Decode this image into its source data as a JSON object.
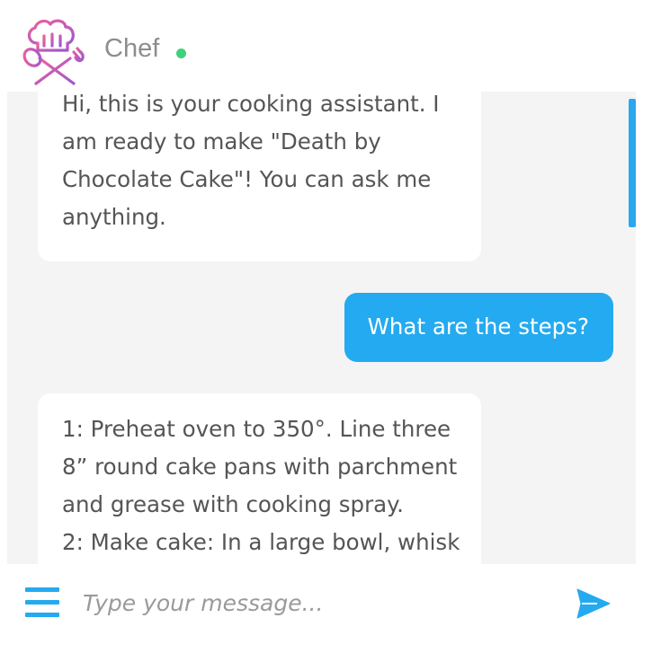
{
  "header": {
    "bot_name": "Chef",
    "status": "online",
    "status_color": "#3ed17b",
    "logo_icon": "chef-hat-utensils-icon"
  },
  "messages": [
    {
      "sender": "bot",
      "lines": [
        "Hi, this is your cooking assistant. I",
        "am ready to make \"Death by",
        "Chocolate Cake\"! You can ask me",
        "anything."
      ]
    },
    {
      "sender": "user",
      "text": "What are the steps?"
    },
    {
      "sender": "bot",
      "lines": [
        "1: Preheat oven to 350°. Line three",
        "8” round cake pans with parchment",
        "and grease with cooking spray.",
        "2: Make cake: In a large bowl, whisk"
      ]
    }
  ],
  "input": {
    "placeholder": "Type your message...",
    "value": ""
  },
  "icons": {
    "menu": "hamburger-menu-icon",
    "send": "send-icon"
  },
  "colors": {
    "accent": "#24aaf0",
    "chat_background": "#f4f4f4",
    "bot_bubble": "#ffffff",
    "bot_text": "#555555",
    "user_text": "#ffffff"
  }
}
